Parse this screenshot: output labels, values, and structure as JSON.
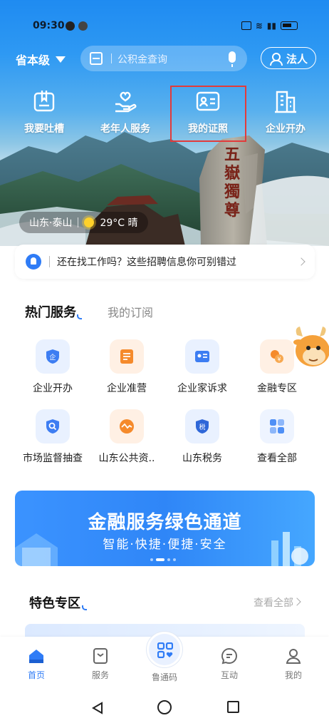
{
  "status_bar": {
    "time": "09:30"
  },
  "top_bar": {
    "region": "省本级",
    "search_placeholder": "公积金查询",
    "legal_label": "法人"
  },
  "quick_links": [
    {
      "label": "我要吐槽",
      "icon": "complaint-icon"
    },
    {
      "label": "老年人服务",
      "icon": "elderly-service-icon"
    },
    {
      "label": "我的证照",
      "icon": "id-card-icon"
    },
    {
      "label": "企业开办",
      "icon": "building-icon"
    }
  ],
  "hero": {
    "location": "山东·泰山",
    "weather": "29°C 晴",
    "rock_inscription": "五嶽獨尊"
  },
  "notice": {
    "text": "还在找工作吗？这些招聘信息你可别错过"
  },
  "services": {
    "tab_active": "热门服务",
    "tab_inactive": "我的订阅",
    "items": [
      {
        "label": "企业开办",
        "icon": "enterprise-shield-icon",
        "color": "#e9f1ff"
      },
      {
        "label": "企业准营",
        "icon": "license-icon",
        "color": "#fff0e4"
      },
      {
        "label": "企业家诉求",
        "icon": "entrepreneur-card-icon",
        "color": "#e9f1ff"
      },
      {
        "label": "金融专区",
        "icon": "coins-icon",
        "color": "#fff0e4"
      },
      {
        "label": "市场监督抽查",
        "icon": "inspection-icon",
        "color": "#e9f1ff"
      },
      {
        "label": "山东公共资..",
        "icon": "public-resource-icon",
        "color": "#fff0e4"
      },
      {
        "label": "山东税务",
        "icon": "tax-shield-icon",
        "color": "#e9f1ff"
      },
      {
        "label": "查看全部",
        "icon": "grid-apps-icon",
        "color": "#eef4ff"
      }
    ]
  },
  "banner": {
    "title": "金融服务绿色通道",
    "subtitle": "智能·快捷·便捷·安全"
  },
  "featured": {
    "title": "特色专区",
    "more": "查看全部"
  },
  "bottom_nav": {
    "home": "首页",
    "service": "服务",
    "center": "鲁通码",
    "interact": "互动",
    "mine": "我的"
  },
  "colors": {
    "accent": "#2f7cf6",
    "highlight_border": "#e23b3b"
  }
}
